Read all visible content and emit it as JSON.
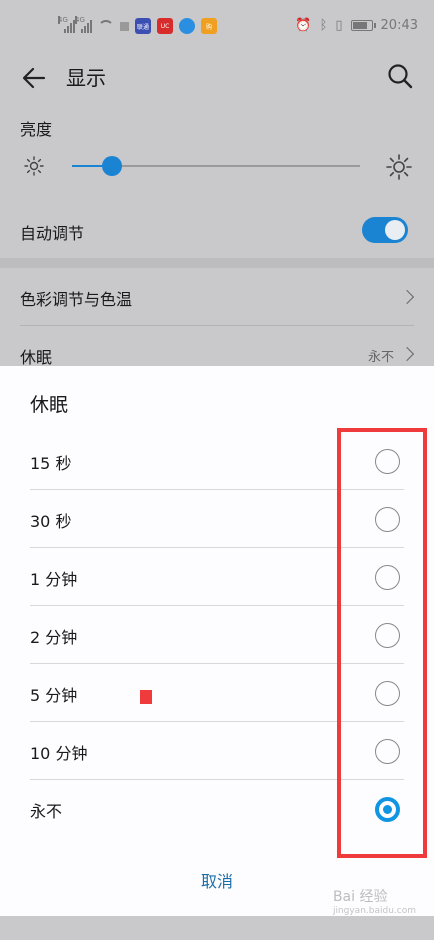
{
  "status_bar": {
    "time": "20:43",
    "app_badges": [
      "联通",
      "UC",
      "",
      "购"
    ]
  },
  "header": {
    "title": "显示"
  },
  "brightness": {
    "label": "亮度",
    "level": 0.14,
    "auto_label": "自动调节",
    "auto_enabled": true
  },
  "settings": {
    "color_label": "色彩调节与色温",
    "sleep_label": "休眠",
    "sleep_value": "永不"
  },
  "dialog": {
    "title": "休眠",
    "options": [
      {
        "label": "15 秒",
        "selected": false
      },
      {
        "label": "30 秒",
        "selected": false
      },
      {
        "label": "1 分钟",
        "selected": false
      },
      {
        "label": "2 分钟",
        "selected": false
      },
      {
        "label": "5 分钟",
        "selected": false
      },
      {
        "label": "10 分钟",
        "selected": false
      },
      {
        "label": "永不",
        "selected": true
      }
    ],
    "cancel_label": "取消"
  },
  "watermark": {
    "brand": "Bai 经验",
    "url": "jingyan.baidu.com"
  },
  "colors": {
    "accent": "#1b84d2",
    "radio_selected": "#1095e3",
    "highlight": "#ef3b3b",
    "overlay_background": "#c9c8cb",
    "dialog_background": "#fdfcff"
  }
}
